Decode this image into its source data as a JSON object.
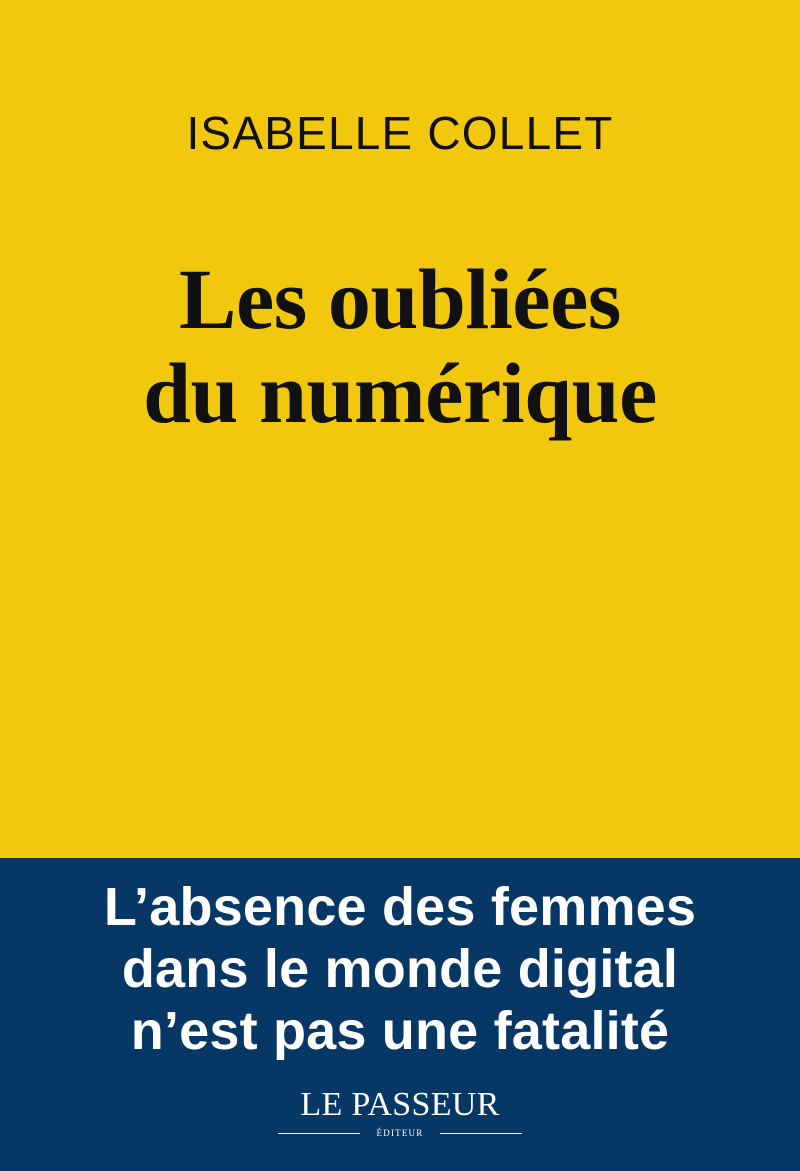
{
  "cover": {
    "author": "ISABELLE COLLET",
    "title_lines": [
      "Les oubliées",
      "du numérique"
    ],
    "subtitle_lines": [
      "L’absence des femmes",
      "dans le monde digital",
      "n’est pas une fatalité"
    ],
    "publisher": {
      "name": "LE PASSEUR",
      "subtitle": "ÉDITEUR"
    },
    "colors": {
      "background": "#f2c80f",
      "band": "#073765",
      "text_dark": "#111111",
      "text_light": "#ffffff"
    }
  }
}
